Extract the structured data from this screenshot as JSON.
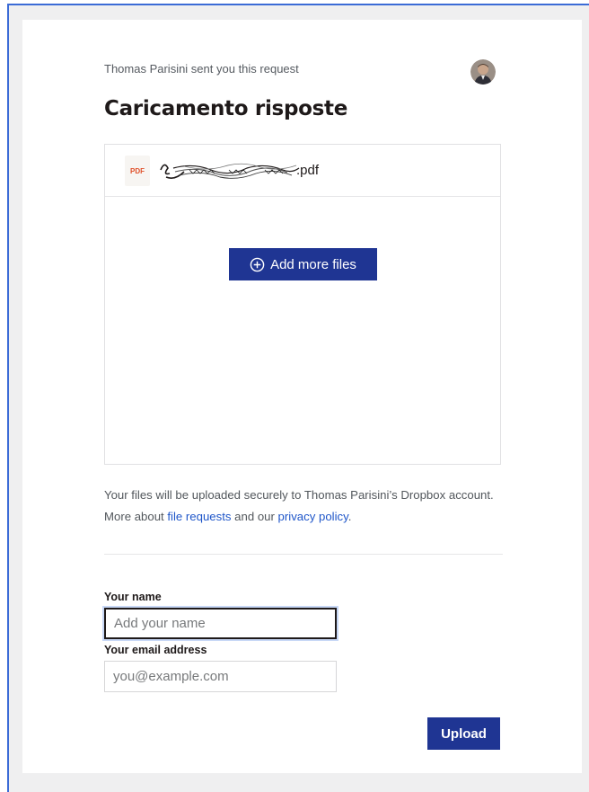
{
  "request": {
    "sender_line": "Thomas Parisini sent you this request",
    "title": "Caricamento risposte"
  },
  "file": {
    "icon_label": "PDF",
    "extension": ".pdf",
    "add_more_label": "Add more files"
  },
  "info": {
    "text_1": "Your files will be uploaded securely to Thomas Parisini’s Dropbox account. More about ",
    "link_file_requests": "file requests",
    "text_2": " and our ",
    "link_privacy": "privacy policy",
    "text_3": "."
  },
  "form": {
    "name_label": "Your name",
    "name_placeholder": "Add your name",
    "email_label": "Your email address",
    "email_placeholder": "you@example.com",
    "upload_label": "Upload"
  },
  "colors": {
    "primary_button": "#1f3593",
    "link": "#1f56c9",
    "focus_ring": "#c8d8f6"
  }
}
